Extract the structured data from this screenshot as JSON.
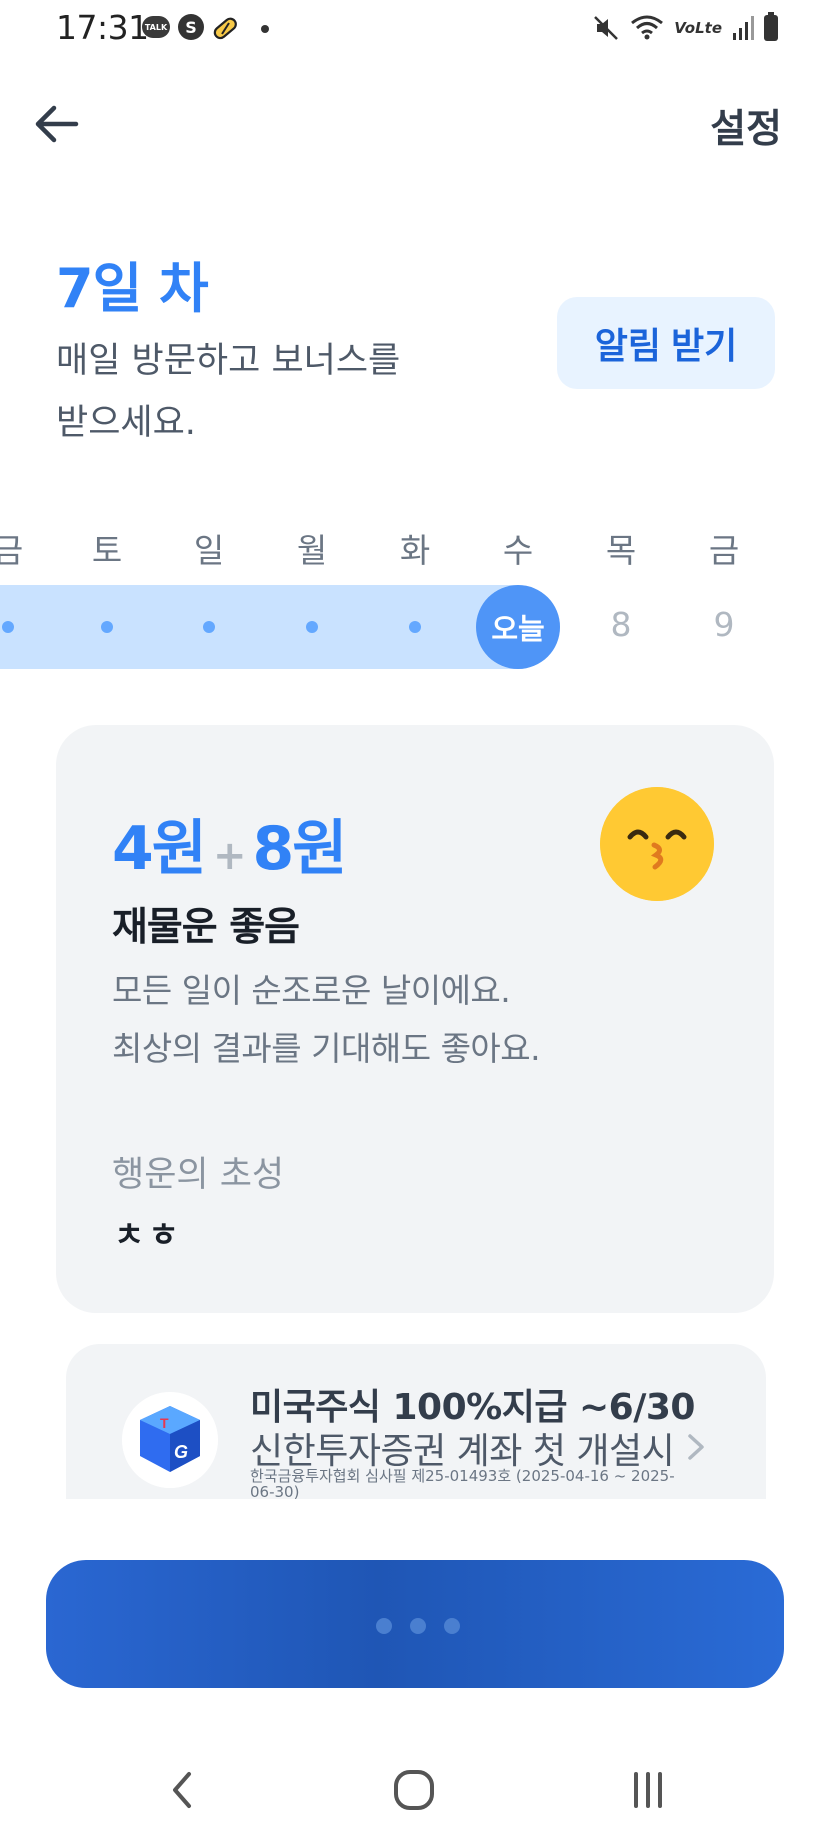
{
  "status_bar": {
    "time": "17:31",
    "talk_badge": "TALK",
    "network_label": "VoLte"
  },
  "header": {
    "back_icon": "arrow-left-icon",
    "settings_label": "설정"
  },
  "intro": {
    "day_title": "7일 차",
    "line1": "매일 방문하고 보너스를",
    "line2": "받으세요.",
    "alarm_button_label": "알림 받기"
  },
  "week": {
    "weekdays": [
      "금",
      "토",
      "일",
      "월",
      "화",
      "수",
      "목",
      "금"
    ],
    "today_label": "오늘",
    "future_days": [
      "8",
      "9"
    ]
  },
  "fortune_card": {
    "base_amount": "4원",
    "plus_sign": "+",
    "bonus_amount": "8원",
    "title": "재물운 좋음",
    "desc_line1": "모든 일이 순조로운 날이에요.",
    "desc_line2": "최상의 결과를 기대해도 좋아요.",
    "lucky_label": "행운의 초성",
    "lucky_value": "ㅊㅎ",
    "emoji_icon": "kissing-face-icon"
  },
  "ad": {
    "title": "미국주식 100%지급 ~6/30",
    "subtitle": "신한투자증권 계좌 첫 개설시",
    "note": "한국금융투자협회 심사필 제25-01493호 (2025-04-16 ~ 2025-06-30)",
    "logo_letters": [
      "T",
      "G"
    ]
  },
  "colors": {
    "accent": "#3182f6",
    "strip": "#c9e2ff",
    "button": "#2561c8"
  }
}
